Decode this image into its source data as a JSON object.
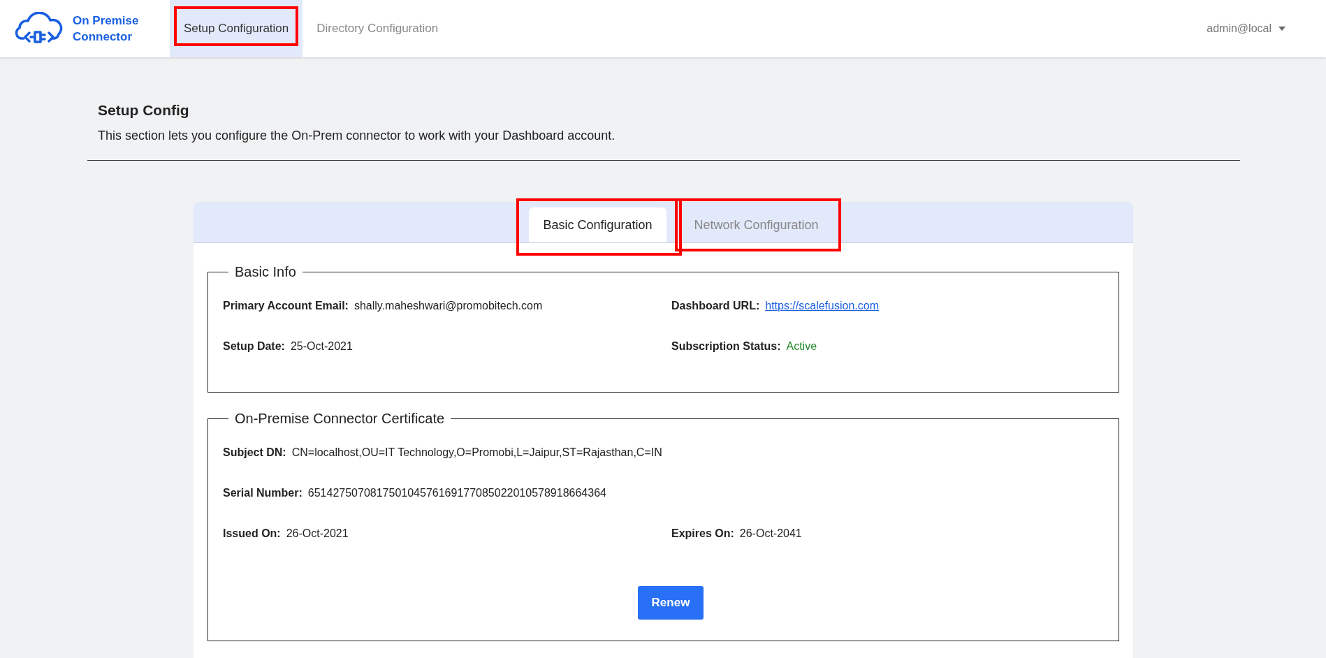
{
  "brand": {
    "name": "On Premise Connector"
  },
  "nav": [
    {
      "label": "Setup Configuration",
      "selected": true,
      "highlighted": true
    },
    {
      "label": "Directory Configuration",
      "selected": false,
      "highlighted": false
    }
  ],
  "user_menu": {
    "label": "admin@local"
  },
  "page": {
    "title": "Setup Config",
    "description": "This section lets you configure the On-Prem connector to work with your Dashboard account."
  },
  "tabs": [
    {
      "label": "Basic Configuration",
      "selected": true,
      "highlighted": true
    },
    {
      "label": "Network Configuration",
      "selected": false,
      "highlighted": true
    }
  ],
  "sections": [
    {
      "legend": "Basic Info",
      "rows": [
        [
          {
            "label": "Primary Account Email:",
            "value": "shally.maheshwari@promobitech.com",
            "kind": "text"
          },
          {
            "label": "Dashboard URL:",
            "value": "https://scalefusion.com",
            "kind": "link"
          }
        ],
        [
          {
            "label": "Setup Date:",
            "value": "25-Oct-2021",
            "kind": "text"
          },
          {
            "label": "Subscription Status:",
            "value": "Active",
            "kind": "status"
          }
        ]
      ]
    },
    {
      "legend": "On-Premise Connector Certificate",
      "rows": [
        [
          {
            "label": "Subject DN:",
            "value": "CN=localhost,OU=IT Technology,O=Promobi,L=Jaipur,ST=Rajasthan,C=IN",
            "kind": "text"
          }
        ],
        [
          {
            "label": "Serial Number:",
            "value": "651427507081750104576169177085022010578918664364",
            "kind": "text"
          }
        ],
        [
          {
            "label": "Issued On:",
            "value": "26-Oct-2021",
            "kind": "text"
          },
          {
            "label": "Expires On:",
            "value": "26-Oct-2041",
            "kind": "text"
          }
        ]
      ],
      "button": "Renew"
    }
  ]
}
